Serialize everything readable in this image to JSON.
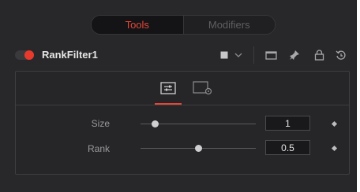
{
  "tabs": [
    {
      "label": "Tools",
      "active": true
    },
    {
      "label": "Modifiers",
      "active": false
    }
  ],
  "node": {
    "name": "RankFilter1",
    "enabled": true,
    "toggle_color": "#e83a2c"
  },
  "header_icons": [
    "color-swatch-icon",
    "chevron-down-icon",
    "view-icon",
    "pin-icon",
    "lock-icon",
    "reset-icon"
  ],
  "subtabs": [
    {
      "icon": "controls-icon",
      "active": true
    },
    {
      "icon": "settings-icon",
      "active": false
    }
  ],
  "controls": [
    {
      "label": "Size",
      "value": "1",
      "slider_fraction": 0.13
    },
    {
      "label": "Rank",
      "value": "0.5",
      "slider_fraction": 0.5
    }
  ],
  "accent_color": "#e4473a"
}
